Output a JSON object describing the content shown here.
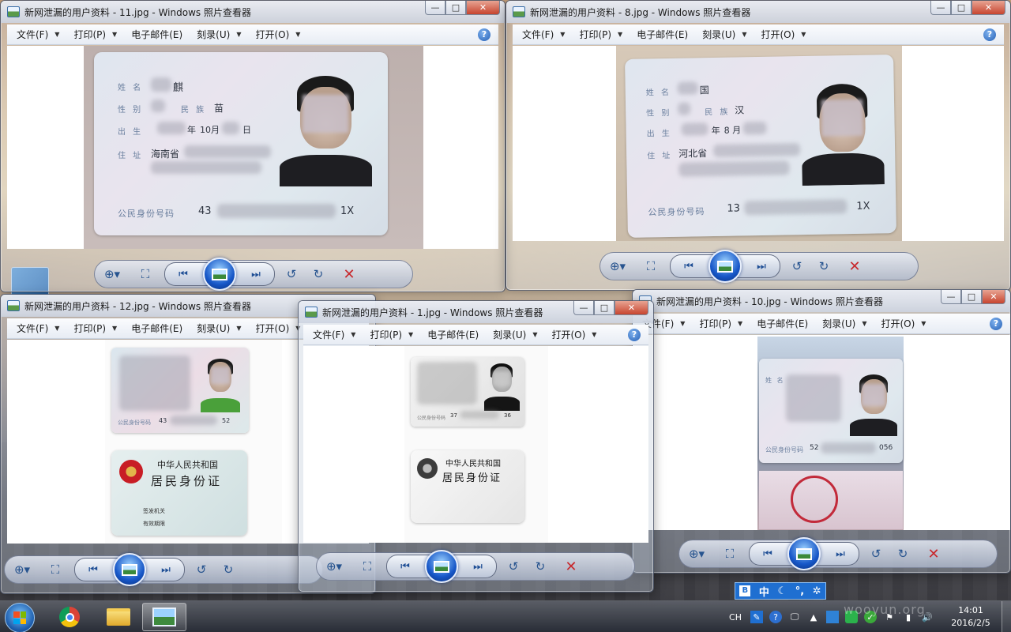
{
  "windows": {
    "w11": {
      "title": "新网泄漏的用户资料 - 11.jpg - Windows 照片查看器"
    },
    "w8": {
      "title": "新网泄漏的用户资料 - 8.jpg - Windows 照片查看器"
    },
    "w12": {
      "title": "新网泄漏的用户资料 - 12.jpg - Windows 照片查看器"
    },
    "w1": {
      "title": "新网泄漏的用户资料 - 1.jpg - Windows 照片查看器"
    },
    "w10": {
      "title": "新网泄漏的用户资料 - 10.jpg - Windows 照片查看器"
    }
  },
  "menu": {
    "file": "文件(F)",
    "print": "打印(P)",
    "email": "电子邮件(E)",
    "burn": "刻录(U)",
    "open": "打开(O)",
    "help_icon": "help-icon"
  },
  "caption": {
    "minimize": "—",
    "maximize": "□",
    "close": "✕"
  },
  "controls_icons": [
    "zoom-icon",
    "fit-window-icon",
    "previous-icon",
    "slideshow-icon",
    "next-icon",
    "rotate-ccw-icon",
    "rotate-cw-icon",
    "delete-icon"
  ],
  "card11": {
    "name_label": "姓 名",
    "name_value": "麒",
    "sex_label": "性 别",
    "ethnicity_label": "民 族",
    "ethnicity_value": "苗",
    "birth_label": "出 生",
    "birth_year": "年",
    "birth_month": "10月",
    "birth_day": "日",
    "address_label": "住 址",
    "address_value": "海南省",
    "id_label": "公民身份号码",
    "id_prefix": "43",
    "id_suffix": "1X"
  },
  "card8": {
    "name_label": "姓 名",
    "name_value": "国",
    "sex_label": "性 别",
    "ethnicity_label": "民 族",
    "ethnicity_value": "汉",
    "birth_label": "出 生",
    "birth_year": "年",
    "birth_month": "8 月",
    "address_label": "住 址",
    "address_value": "河北省",
    "id_label": "公民身份号码",
    "id_prefix": "13",
    "id_suffix": "1X"
  },
  "card12": {
    "id_label": "公民身份号码",
    "id_prefix": "43",
    "id_suffix": "52",
    "back_country": "中华人民共和国",
    "back_title": "居民身份证",
    "issuer_label": "签发机关",
    "validity_label": "有效期限"
  },
  "card1": {
    "id_label": "公民身份号码",
    "id_prefix": "37",
    "id_suffix": "36",
    "back_country": "中华人民共和国",
    "back_title": "居民身份证"
  },
  "card10": {
    "name_label": "姓 名",
    "id_label": "公民身份号码",
    "id_prefix": "52",
    "id_suffix": "056"
  },
  "ime": {
    "lang": "中"
  },
  "tray": {
    "lang_indicator": "CH",
    "time": "14:01",
    "date": "2016/2/5"
  },
  "watermark": "wooyun.org"
}
